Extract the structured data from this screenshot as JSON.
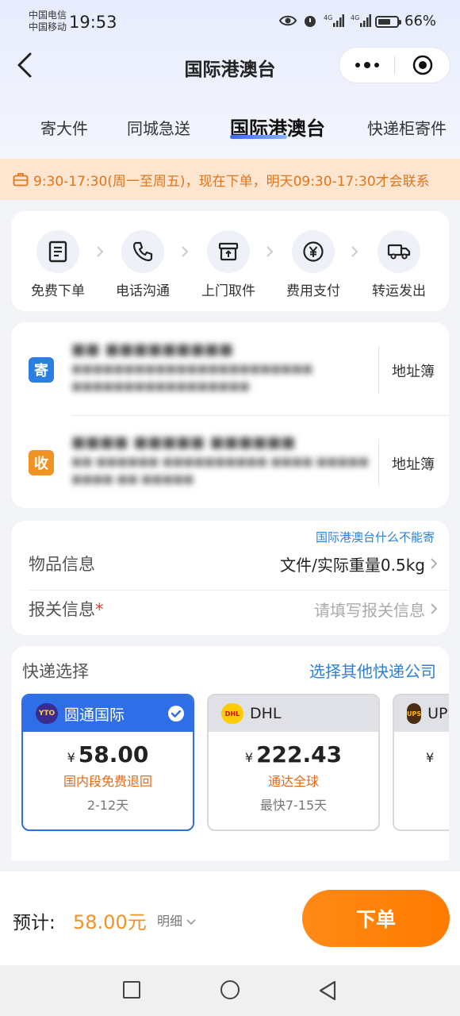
{
  "status_bar": {
    "carrier1": "中国电信",
    "carrier2": "中国移动",
    "time": "19:53",
    "battery": "66%",
    "battery_level": 0.66,
    "icons": [
      "eye-icon",
      "alarm-icon",
      "signal-4g-icon",
      "signal-4g-icon",
      "battery-icon"
    ]
  },
  "nav": {
    "title": "国际港澳台",
    "icons": [
      "back-icon",
      "more-icon",
      "target-icon"
    ]
  },
  "tabs": [
    {
      "label": "寄大件"
    },
    {
      "label": "同城急送"
    },
    {
      "label": "国际港澳台",
      "active": true
    },
    {
      "label": "快递柜寄件"
    }
  ],
  "notice": {
    "icon": "briefcase-icon",
    "text": "9:30-17:30(周一至周五)，现在下单，明天09:30-17:30才会联系"
  },
  "steps": [
    {
      "label": "免费下单",
      "icon": "document-icon"
    },
    {
      "label": "电话沟通",
      "icon": "phone-icon"
    },
    {
      "label": "上门取件",
      "icon": "pickup-box-icon"
    },
    {
      "label": "费用支付",
      "icon": "yen-icon"
    },
    {
      "label": "转运发出",
      "icon": "truck-icon"
    }
  ],
  "address": {
    "sender": {
      "badge": "寄",
      "book": "地址簿"
    },
    "receiver": {
      "badge": "收",
      "book": "地址簿"
    }
  },
  "items": {
    "link": "国际港澳台什么不能寄",
    "goods_label": "物品信息",
    "goods_value": "文件/实际重量0.5kg",
    "customs_label": "报关信息",
    "customs_required": "*",
    "customs_placeholder": "请填写报关信息"
  },
  "express": {
    "title": "快递选择",
    "other_link": "选择其他快递公司",
    "options": [
      {
        "name": "圆通国际",
        "currency": "¥",
        "price": "58.00",
        "tag": "国内段免费退回",
        "days": "2-12天",
        "selected": true
      },
      {
        "name": "DHL",
        "currency": "¥",
        "price": "222.43",
        "tag": "通达全球",
        "days": "最快7-15天",
        "selected": false
      },
      {
        "name": "UPS",
        "currency": "¥",
        "price": "",
        "tag": "",
        "days": "",
        "selected": false
      }
    ]
  },
  "bottom": {
    "estimate_label": "预计:",
    "estimate_value": "58.00元",
    "detail_label": "明细",
    "order_button": "下单"
  },
  "colors": {
    "accent": "#ff7f0a",
    "link": "#2f80d8",
    "selected": "#2e6fe8",
    "notice_bg": "#fde5cf",
    "notice_text": "#e0751b"
  }
}
